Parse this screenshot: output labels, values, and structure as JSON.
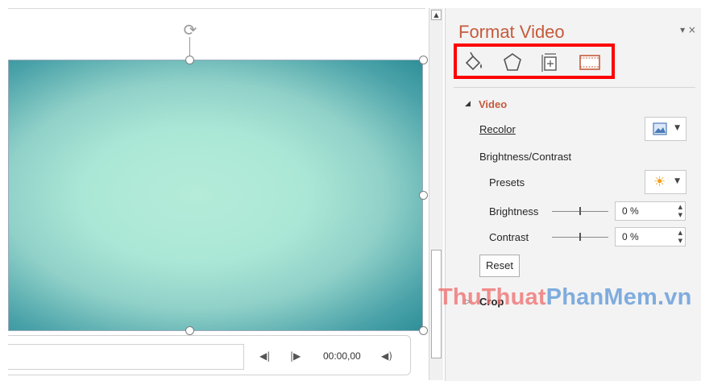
{
  "pane": {
    "title": "Format Video",
    "controls": "▾ ×",
    "tabs": [
      {
        "name": "fill-line-icon"
      },
      {
        "name": "effects-icon"
      },
      {
        "name": "size-properties-icon"
      },
      {
        "name": "video-icon"
      }
    ],
    "video_section": {
      "header": "Video",
      "recolor_label": "Recolor",
      "brightness_contrast_label": "Brightness/Contrast",
      "presets_label": "Presets",
      "brightness_label": "Brightness",
      "brightness_value": "0 %",
      "contrast_label": "Contrast",
      "contrast_value": "0 %",
      "reset_label": "Reset"
    },
    "crop_section": {
      "header": "Crop"
    }
  },
  "media": {
    "time": "00:00,00"
  },
  "watermark": {
    "part1": "ThuThuat",
    "part2": "PhanMem.vn"
  },
  "colors": {
    "accent": "#c55a3c",
    "highlight": "#ff0000"
  }
}
